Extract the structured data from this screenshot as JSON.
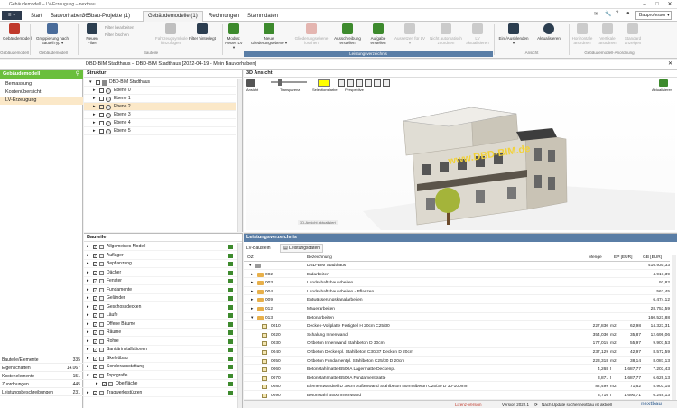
{
  "window": {
    "title": "Gebäudemodell – LV-Erzeugung – nextbau"
  },
  "menu": {
    "app_menu": "≡ ▾",
    "tabs": [
      "Start",
      "Bauvorhaben",
      "365bau-Projekte (1)",
      "Gebäudemodelle (1)",
      "Rechnungen",
      "Stammdaten"
    ],
    "active_tab": 3,
    "user": "Bauprofessor ▾"
  },
  "ribbon": {
    "g1": {
      "btn": "Gebäudemodell",
      "label": "Gebäudemodell"
    },
    "g2": {
      "btn1": "Gruppierung nach BauteilTyp ▾",
      "label": "Gebäudemodell"
    },
    "g3": {
      "btn1": "Neuen Filter",
      "small1": "Filter bearbeiten",
      "small2": "Filter löschen",
      "btn2": "Fahrzeugsymbole hinzufügen",
      "btn3": "Filter hinterlegt",
      "label": "Bauteile"
    },
    "g4": {
      "btn1": "Modus: Neues LV ▾",
      "btn2": "Neue Gliederungsebene ▾",
      "btn3": "Gliederungsebene löschen",
      "btn4": "Ausschreibung erstellen",
      "btn5": "Aufgabe erstellen",
      "btn6": "Aussetzen für LV ▾",
      "btn7": "Nicht automatisch zuordnen",
      "btn8": "LV aktualisieren",
      "label": "Leistungsverzeichnis"
    },
    "g5": {
      "btn1": "Ein-/Ausblenden ▾",
      "btn2": "Aktualisieren",
      "label": "Ansicht"
    },
    "g6": {
      "btn1": "Horizontale anordnen",
      "btn2": "Vertikale anordnen",
      "btn3": "Standard anzeigen",
      "label": "Gebäudemodell-Anordnung"
    }
  },
  "address": "DBD-BIM Stadthaus – DBD-BIM Stadthaus [2022-04-19 - Mein Bauvorhaben]",
  "left": {
    "header": "Gebäudemodell",
    "items": [
      "Bemassung",
      "Kostenübersicht",
      "LV-Erzeugung"
    ],
    "selected": 2,
    "stats": [
      {
        "k": "Bauteile/Elemente",
        "v": "335"
      },
      {
        "k": "Eigenschaften",
        "v": "14.067"
      },
      {
        "k": "Kostenelemente",
        "v": "151"
      },
      {
        "k": "Zuordnungen",
        "v": "445"
      },
      {
        "k": "Leistungsbeschreibungen",
        "v": "231"
      }
    ]
  },
  "struktur": {
    "title": "Struktur",
    "root": "DBD-BIM Stadthaus",
    "levels": [
      "Ebene 0",
      "Ebene 1",
      "Ebene 2",
      "Ebene 3",
      "Ebene 4",
      "Ebene 5"
    ],
    "selected": 2
  },
  "view3d": {
    "title": "3D Ansicht",
    "ansicht": "Ansicht",
    "transparenz": "Transparenz",
    "farbe": "Selektionsfarbe",
    "perspektive": "Perspektive",
    "aktualisieren": "Aktualisieren",
    "banner": "www.DBD-BIM.de",
    "status": "3D-Ansicht aktualisiert",
    "accent": "#ffff00"
  },
  "bauteile": {
    "title": "Bauteile",
    "items": [
      "Allgemeines Modell",
      "Auflager",
      "Bepflanzung",
      "Dächer",
      "Fenster",
      "Fundamente",
      "Geländer",
      "Geschossdecken",
      "Läufe",
      "Offene Bäume",
      "Räume",
      "Rohre",
      "Sanitärinstallationen",
      "Skelettbau",
      "Sonderausstattung",
      "Topografie",
      "Oberfläche",
      "Tragwerksstützen"
    ]
  },
  "leist": {
    "title": "Leistungsverzeichnis",
    "tab1": "LV-Baustein",
    "tab2": "Leistungsdaten",
    "cols": {
      "oz": "OZ",
      "bez": "Bezeichnung",
      "menge": "Menge",
      "ep": "EP [EUR]",
      "gb": "GB [EUR]"
    },
    "rows": [
      {
        "oz": "",
        "bez": "DBD-BIM Stadthaus",
        "menge": "",
        "einh": "",
        "ep": "",
        "gb": "416.930,33",
        "t": "root"
      },
      {
        "oz": "002",
        "bez": "Erdarbeiten",
        "menge": "",
        "einh": "",
        "ep": "",
        "gb": "4.917,39",
        "t": "f"
      },
      {
        "oz": "003",
        "bez": "Landschaftsbauarbeiten",
        "menge": "",
        "einh": "",
        "ep": "",
        "gb": "92,82",
        "t": "f"
      },
      {
        "oz": "004",
        "bez": "Landschaftsbauarbeiten - Pflanzen",
        "menge": "",
        "einh": "",
        "ep": "",
        "gb": "563,45",
        "t": "f"
      },
      {
        "oz": "009",
        "bez": "Entwässerungskanalarbeiten",
        "menge": "",
        "einh": "",
        "ep": "",
        "gb": "6.474,12",
        "t": "f"
      },
      {
        "oz": "012",
        "bez": "Mauerarbeiten",
        "menge": "",
        "einh": "",
        "ep": "",
        "gb": "28.753,59",
        "t": "f"
      },
      {
        "oz": "013",
        "bez": "Betonarbeiten",
        "menge": "",
        "einh": "",
        "ep": "",
        "gb": "160.521,88",
        "t": "f"
      },
      {
        "oz": "0010",
        "bez": "Decken-Vollplatte Fertigteil H 20cm C25/30",
        "menge": "227,830",
        "einh": "m2",
        "ep": "62,98",
        "gb": "14.323,31",
        "t": "p"
      },
      {
        "oz": "0020",
        "bez": "Schalung Innenwand",
        "menge": "354,030",
        "einh": "m2",
        "ep": "35,87",
        "gb": "12.699,06",
        "t": "p"
      },
      {
        "oz": "0030",
        "bez": "Ortbeton Innenwand Stahlbeton D 30cm",
        "menge": "177,015",
        "einh": "m2",
        "ep": "55,97",
        "gb": "9.907,53",
        "t": "p"
      },
      {
        "oz": "0040",
        "bez": "Ortbeton Deckenpl. Stahlbeton C30/37 Decken D 20cm",
        "menge": "237,129",
        "einh": "m2",
        "ep": "42,97",
        "gb": "8.572,59",
        "t": "p"
      },
      {
        "oz": "0050",
        "bez": "Ortbeton Fundamentpl. Stahlbeton C25/30 D 20cm",
        "menge": "223,318",
        "einh": "m2",
        "ep": "38,14",
        "gb": "8.087,13",
        "t": "p"
      },
      {
        "oz": "0060",
        "bez": "Betonstahlmatte B500A Lagermatte Deckenpl.",
        "menge": "4,268",
        "einh": "t",
        "ep": "1.687,77",
        "gb": "7.203,43",
        "t": "p"
      },
      {
        "oz": "0070",
        "bez": "Betonstahlmatte B500A Fundamentplatte",
        "menge": "3,871",
        "einh": "t",
        "ep": "1.687,77",
        "gb": "6.629,13",
        "t": "p"
      },
      {
        "oz": "0080",
        "bez": "Elementwandteil D 30cm Außenwand Stahlbeton Normalbeton C25/30 D 30-100mm",
        "menge": "82,499",
        "einh": "m2",
        "ep": "71,62",
        "gb": "5.903,15",
        "t": "p"
      },
      {
        "oz": "0090",
        "bez": "Betonstahl B500 Innenwand",
        "menge": "3,716",
        "einh": "t",
        "ep": "1.690,71",
        "gb": "6.246,13",
        "t": "p"
      }
    ]
  },
  "statusbar": {
    "lizenz": "Lizenz-Version",
    "version": "Version 2022.1",
    "update": "Nach Update suchen",
    "copyright": "nextbau ist aktuell",
    "brand": "nextbau"
  }
}
